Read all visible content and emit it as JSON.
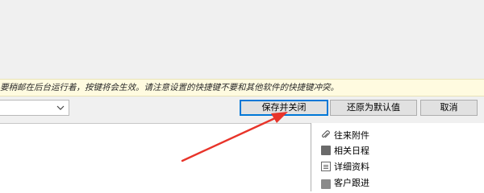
{
  "hint_text": "要稍邮在后台运行着，按键将会生效。请注意设置的快捷键不要和其他软件的快捷键冲突。",
  "buttons": {
    "save_close": "保存并关闭",
    "restore_default": "还原为默认值",
    "cancel": "取消"
  },
  "select": {
    "value": ""
  },
  "side_menu": {
    "items": [
      {
        "label": "往来附件",
        "icon": "paperclip-icon"
      },
      {
        "label": "相关日程",
        "icon": "calendar-icon"
      },
      {
        "label": "详细资料",
        "icon": "document-icon"
      },
      {
        "label": "客户跟进",
        "icon": "box-icon"
      }
    ]
  },
  "colors": {
    "dialog_bg": "#f0f0f0",
    "hint_bg": "#fffbe0",
    "button_bg": "#e1e1e1",
    "focus_border": "#0078d7",
    "arrow": "#e8342a"
  }
}
